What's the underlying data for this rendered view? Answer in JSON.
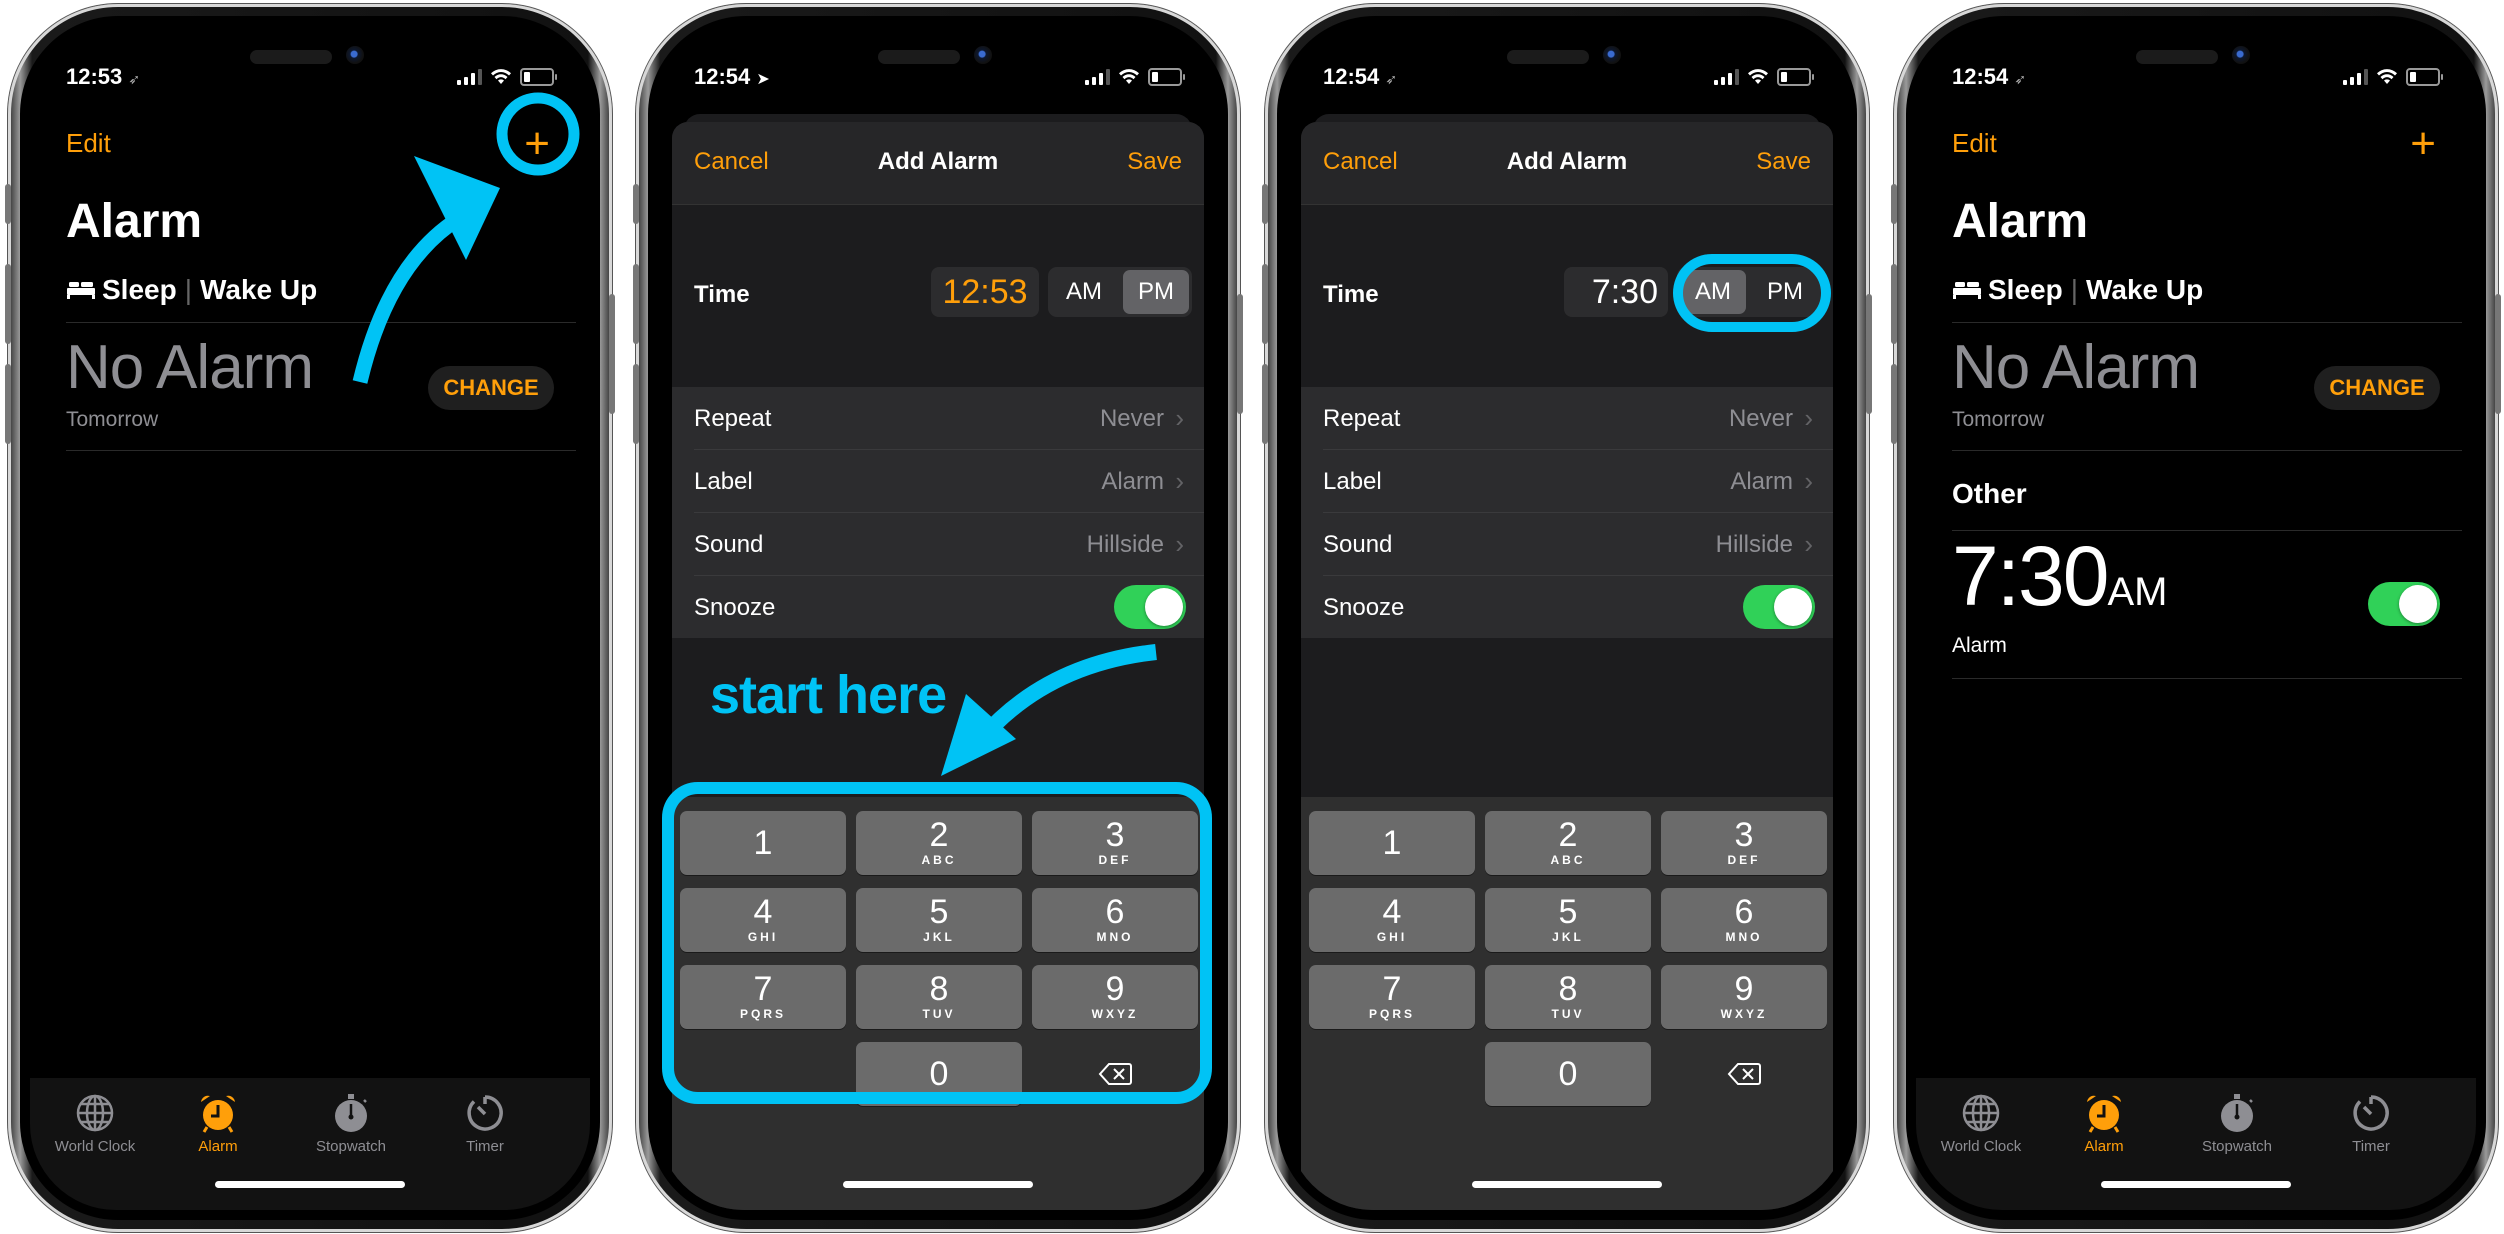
{
  "colors": {
    "accent": "#ff9f0a",
    "annotation": "#00c3f5",
    "toggle_on": "#30d158",
    "secondary_text": "#8e8e93"
  },
  "phones": [
    {
      "status": {
        "time": "12:53",
        "location_icon": "location-arrow-outline"
      },
      "nav": {
        "edit": "Edit",
        "add_icon": "plus-icon"
      },
      "title": "Alarm",
      "sleep": {
        "icon": "bed-icon",
        "sleep": "Sleep",
        "sep": "|",
        "wake": "Wake Up"
      },
      "no_alarm": "No Alarm",
      "tomorrow": "Tomorrow",
      "change": "CHANGE",
      "tabs": [
        {
          "label": "World Clock",
          "icon": "globe-icon",
          "active": false
        },
        {
          "label": "Alarm",
          "icon": "alarm-clock-icon",
          "active": true
        },
        {
          "label": "Stopwatch",
          "icon": "stopwatch-icon",
          "active": false
        },
        {
          "label": "Timer",
          "icon": "timer-icon",
          "active": false
        }
      ]
    },
    {
      "status": {
        "time": "12:54",
        "location_icon": "location-arrow-filled"
      },
      "header": {
        "cancel": "Cancel",
        "title": "Add Alarm",
        "save": "Save"
      },
      "time": {
        "label": "Time",
        "value": "12:53",
        "am": "AM",
        "pm": "PM",
        "selected": "PM"
      },
      "rows": [
        {
          "key": "Repeat",
          "value": "Never"
        },
        {
          "key": "Label",
          "value": "Alarm"
        },
        {
          "key": "Sound",
          "value": "Hillside"
        },
        {
          "key": "Snooze",
          "toggle": true
        }
      ],
      "annotation": "start here"
    },
    {
      "status": {
        "time": "12:54",
        "location_icon": "location-arrow-outline"
      },
      "header": {
        "cancel": "Cancel",
        "title": "Add Alarm",
        "save": "Save"
      },
      "time": {
        "label": "Time",
        "value": "7:30",
        "am": "AM",
        "pm": "PM",
        "selected": "AM"
      },
      "rows": [
        {
          "key": "Repeat",
          "value": "Never"
        },
        {
          "key": "Label",
          "value": "Alarm"
        },
        {
          "key": "Sound",
          "value": "Hillside"
        },
        {
          "key": "Snooze",
          "toggle": true
        }
      ]
    },
    {
      "status": {
        "time": "12:54",
        "location_icon": "location-arrow-outline"
      },
      "nav": {
        "edit": "Edit",
        "add_icon": "plus-icon"
      },
      "title": "Alarm",
      "sleep": {
        "icon": "bed-icon",
        "sleep": "Sleep",
        "sep": "|",
        "wake": "Wake Up"
      },
      "no_alarm": "No Alarm",
      "tomorrow": "Tomorrow",
      "change": "CHANGE",
      "other": {
        "heading": "Other",
        "alarm": {
          "time": "7:30",
          "ampm": "AM",
          "label": "Alarm",
          "enabled": true
        }
      },
      "tabs": [
        {
          "label": "World Clock",
          "icon": "globe-icon",
          "active": false
        },
        {
          "label": "Alarm",
          "icon": "alarm-clock-icon",
          "active": true
        },
        {
          "label": "Stopwatch",
          "icon": "stopwatch-icon",
          "active": false
        },
        {
          "label": "Timer",
          "icon": "timer-icon",
          "active": false
        }
      ]
    }
  ],
  "keypad": [
    {
      "n": "1",
      "l": ""
    },
    {
      "n": "2",
      "l": "ABC"
    },
    {
      "n": "3",
      "l": "DEF"
    },
    {
      "n": "4",
      "l": "GHI"
    },
    {
      "n": "5",
      "l": "JKL"
    },
    {
      "n": "6",
      "l": "MNO"
    },
    {
      "n": "7",
      "l": "PQRS"
    },
    {
      "n": "8",
      "l": "TUV"
    },
    {
      "n": "9",
      "l": "WXYZ"
    },
    {
      "n": "",
      "l": ""
    },
    {
      "n": "0",
      "l": ""
    },
    {
      "n": "delete",
      "l": ""
    }
  ]
}
